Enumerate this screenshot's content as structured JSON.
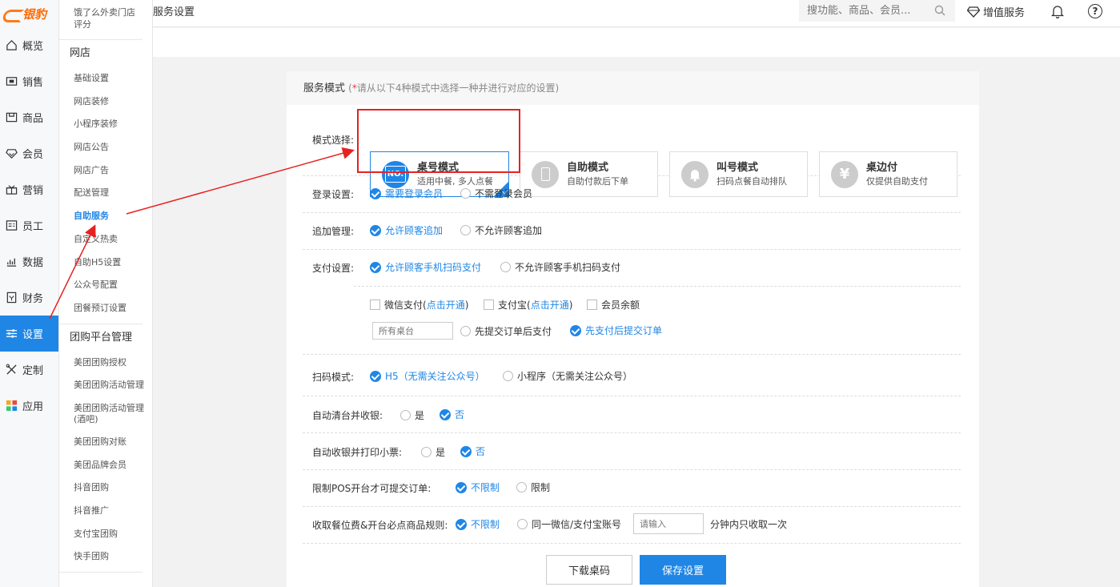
{
  "brand": {
    "logo_text": "银豹"
  },
  "nav": {
    "items": [
      {
        "label": "概览",
        "icon": "home-icon"
      },
      {
        "label": "销售",
        "icon": "sales-icon"
      },
      {
        "label": "商品",
        "icon": "product-icon"
      },
      {
        "label": "会员",
        "icon": "member-icon"
      },
      {
        "label": "营销",
        "icon": "marketing-icon"
      },
      {
        "label": "员工",
        "icon": "staff-icon"
      },
      {
        "label": "数据",
        "icon": "data-icon"
      },
      {
        "label": "财务",
        "icon": "finance-icon"
      },
      {
        "label": "设置",
        "icon": "settings-icon",
        "active": true
      },
      {
        "label": "定制",
        "icon": "custom-icon"
      },
      {
        "label": "应用",
        "icon": "apps-icon"
      }
    ]
  },
  "subnav": {
    "top_item": "饿了么外卖门店评分",
    "group1": "网店",
    "group1_items": [
      "基础设置",
      "网店装修",
      "小程序装修",
      "网店公告",
      "网店广告",
      "配送管理",
      "自助服务",
      "自定义热卖",
      "自助H5设置",
      "公众号配置",
      "团餐预订设置"
    ],
    "group2": "团购平台管理",
    "group2_items": [
      "美团团购授权",
      "美团团购活动管理",
      "美团团购活动管理(酒吧)",
      "美团团购对账",
      "美团品牌会员",
      "抖音团购",
      "抖音推广",
      "支付宝团购",
      "快手团购"
    ]
  },
  "topbar": {
    "title": "服务设置",
    "search_placeholder": "搜功能、商品、会员...",
    "value_added": "增值服务",
    "help": "?"
  },
  "panel": {
    "title": "服务模式",
    "hint_star": "*",
    "hint_open": "(",
    "hint_text": "请从以下4种模式中选择一种并进行对应的设置)",
    "mode_label": "模式选择:",
    "modes": [
      {
        "title": "桌号模式",
        "desc": "适用中餐, 多人点餐",
        "glyph": "NO."
      },
      {
        "title": "自助模式",
        "desc": "自助付款后下单",
        "glyph": "▯"
      },
      {
        "title": "叫号模式",
        "desc": "扫码点餐自动排队",
        "glyph": "🔔"
      },
      {
        "title": "桌边付",
        "desc": "仅提供自助支付",
        "glyph": "¥"
      }
    ],
    "login": {
      "label": "登录设置:",
      "opt1": "需要登录会员",
      "opt2": "不需登录会员"
    },
    "addon": {
      "label": "追加管理:",
      "opt1": "允许顾客追加",
      "opt2": "不允许顾客追加"
    },
    "pay": {
      "label": "支付设置:",
      "opt1": "允许顾客手机扫码支付",
      "opt2": "不允许顾客手机扫码支付",
      "wechat": "微信支付",
      "alipay": "支付宝",
      "open_link": "点击开通",
      "lp": "(",
      "rp": ")",
      "balance": "会员余额",
      "table_input": "所有桌台",
      "order_first": "先提交订单后支付",
      "pay_first": "先支付后提交订单"
    },
    "scan": {
      "label": "扫码模式:",
      "opt1": "H5（无需关注公众号）",
      "opt2": "小程序（无需关注公众号）"
    },
    "auto_clear": {
      "label": "自动清台并收银:",
      "yes": "是",
      "no": "否"
    },
    "auto_print": {
      "label": "自动收银并打印小票:",
      "yes": "是",
      "no": "否"
    },
    "pos_limit": {
      "label": "限制POS开台才可提交订单:",
      "opt1": "不限制",
      "opt2": "限制"
    },
    "fee_rule": {
      "label": "收取餐位费&开台必点商品规则:",
      "opt1": "不限制",
      "opt2": "同一微信/支付宝账号",
      "input_placeholder": "请输入",
      "suffix": "分钟内只收取一次"
    },
    "btn_download": "下载桌码",
    "btn_save": "保存设置"
  },
  "colors": {
    "accent": "#1f86e6",
    "annotation": "#e82121",
    "logo": "#ff6a00"
  }
}
